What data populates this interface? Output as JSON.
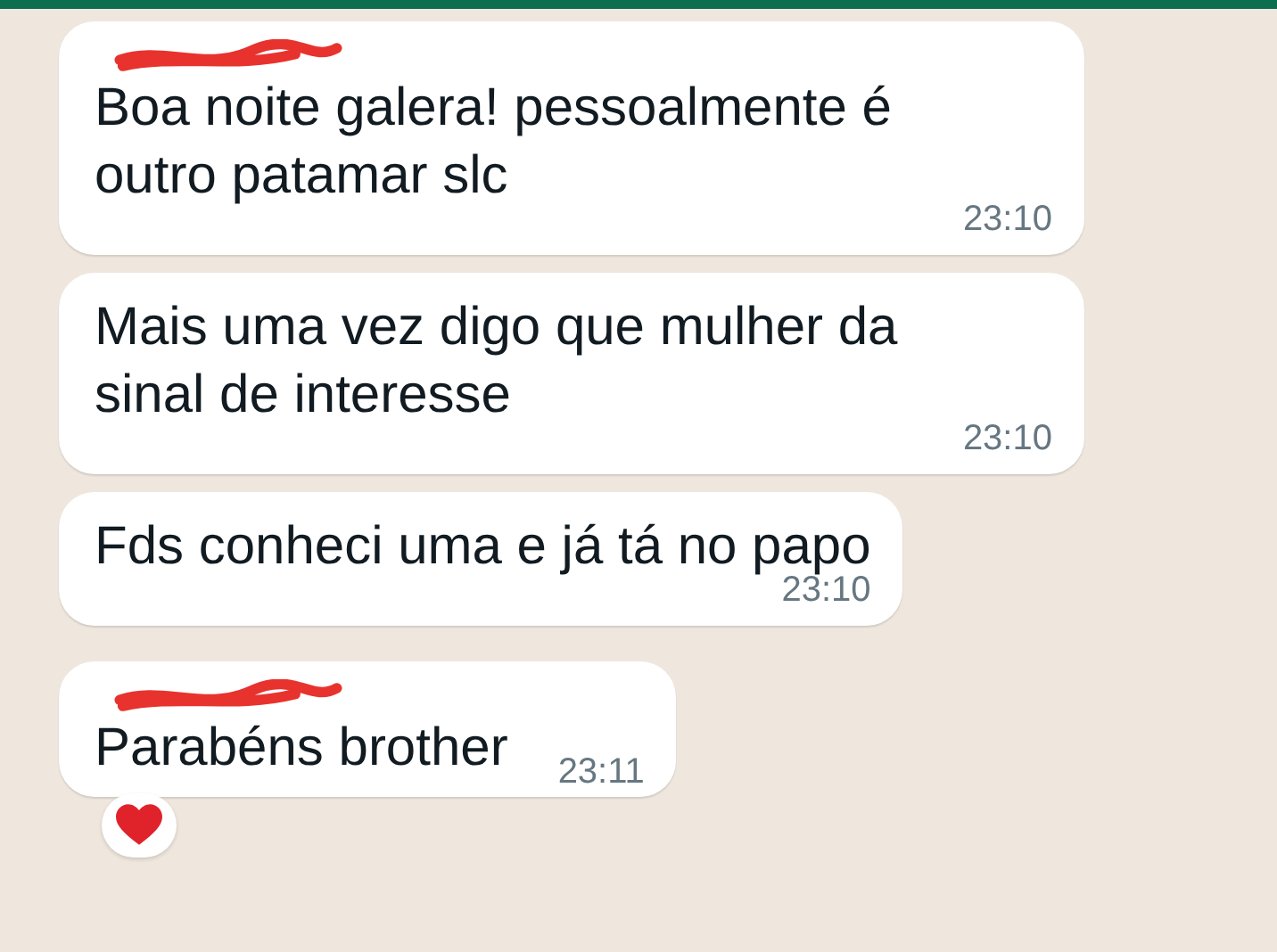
{
  "messages": [
    {
      "sender_redacted": true,
      "text": "Boa noite galera! pessoalmente é outro patamar slc",
      "time": "23:10",
      "kind": "below"
    },
    {
      "sender_redacted": false,
      "text": "Mais uma vez digo que mulher da sinal de interesse",
      "time": "23:10",
      "kind": "below"
    },
    {
      "sender_redacted": false,
      "text": "Fds conheci uma e já tá no papo",
      "time": "23:10",
      "kind": "below"
    },
    {
      "sender_redacted": true,
      "text": "Parabéns brother",
      "time": "23:11",
      "kind": "inline",
      "reaction": {
        "kind": "heart"
      }
    }
  ]
}
